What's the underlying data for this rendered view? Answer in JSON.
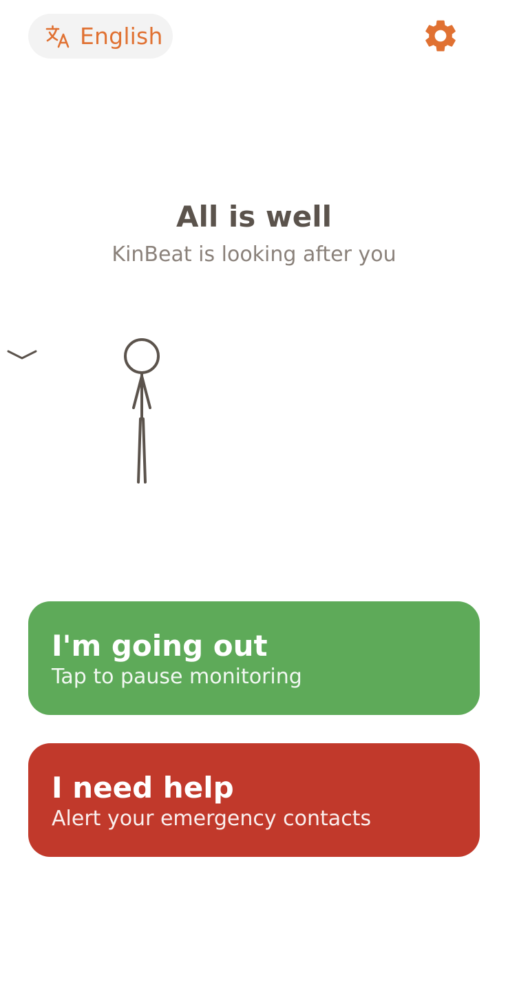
{
  "header": {
    "language_label": "English",
    "language_icon": "translate-icon",
    "settings_icon": "gear-icon"
  },
  "status": {
    "title": "All is well",
    "subtitle": "KinBeat is looking after you"
  },
  "actions": {
    "going_out": {
      "title": "I'm going out",
      "subtitle": "Tap to pause monitoring",
      "color": "#5eaa59"
    },
    "need_help": {
      "title": "I need help",
      "subtitle": "Alert your emergency contacts",
      "color": "#c1392b"
    }
  },
  "colors": {
    "accent": "#e07132",
    "text_dark": "#5b534c",
    "text_muted": "#8a817a",
    "pill_bg": "#f3f3f3"
  }
}
